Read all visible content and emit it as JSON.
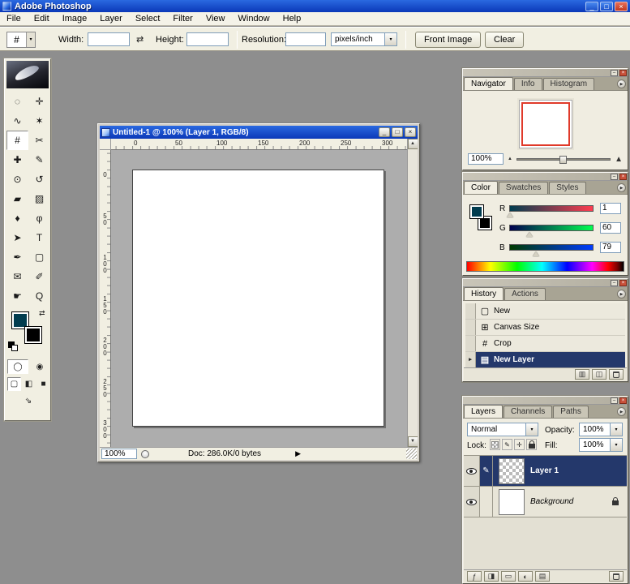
{
  "app": {
    "title": "Adobe Photoshop",
    "window_buttons": {
      "minimize": "_",
      "maximize": "□",
      "close": "×"
    }
  },
  "menu_bar": {
    "items": [
      "File",
      "Edit",
      "Image",
      "Layer",
      "Select",
      "Filter",
      "View",
      "Window",
      "Help"
    ]
  },
  "options_bar": {
    "tool_icon_glyph": "#",
    "tool_dropdown_glyph": "▾",
    "width_label": "Width:",
    "width_value": "",
    "swap_glyph": "⇄",
    "height_label": "Height:",
    "height_value": "",
    "resolution_label": "Resolution:",
    "resolution_value": "",
    "resolution_unit": "pixels/inch",
    "unit_dropdown_glyph": "▾",
    "front_image_button": "Front Image",
    "clear_button": "Clear"
  },
  "toolbox": {
    "tools": [
      {
        "name": "elliptical-marquee-tool",
        "glyph": "◌"
      },
      {
        "name": "move-tool",
        "glyph": "✛"
      },
      {
        "name": "lasso-tool",
        "glyph": "∿"
      },
      {
        "name": "magic-wand-tool",
        "glyph": "✶"
      },
      {
        "name": "crop-tool",
        "glyph": "#",
        "active": true
      },
      {
        "name": "slice-tool",
        "glyph": "✂"
      },
      {
        "name": "healing-brush-tool",
        "glyph": "✚"
      },
      {
        "name": "brush-tool",
        "glyph": "✎"
      },
      {
        "name": "clone-stamp-tool",
        "glyph": "⊙"
      },
      {
        "name": "history-brush-tool",
        "glyph": "↺"
      },
      {
        "name": "eraser-tool",
        "glyph": "▰"
      },
      {
        "name": "gradient-tool",
        "glyph": "▨"
      },
      {
        "name": "blur-tool",
        "glyph": "♦"
      },
      {
        "name": "dodge-tool",
        "glyph": "φ"
      },
      {
        "name": "path-selection-tool",
        "glyph": "➤"
      },
      {
        "name": "type-tool",
        "glyph": "T"
      },
      {
        "name": "pen-tool",
        "glyph": "✒"
      },
      {
        "name": "shape-tool",
        "glyph": "▢"
      },
      {
        "name": "notes-tool",
        "glyph": "✉"
      },
      {
        "name": "eyedropper-tool",
        "glyph": "✐"
      },
      {
        "name": "hand-tool",
        "glyph": "☛"
      },
      {
        "name": "zoom-tool",
        "glyph": "Q"
      }
    ],
    "foreground_color": "#013c4f",
    "background_color": "#000000",
    "swap_glyph": "⇄",
    "quick_mask_buttons": [
      {
        "name": "standard-mode-button",
        "glyph": "◯",
        "active": true
      },
      {
        "name": "quick-mask-mode-button",
        "glyph": "◉"
      }
    ],
    "screen_mode_buttons": [
      {
        "name": "standard-screen-mode-button",
        "glyph": "▢",
        "active": true
      },
      {
        "name": "full-screen-menubar-mode-button",
        "glyph": "◧"
      },
      {
        "name": "full-screen-mode-button",
        "glyph": "■"
      }
    ],
    "imageready_button": {
      "name": "jump-to-imageready-button",
      "glyph": "⇘"
    }
  },
  "document_window": {
    "title": "Untitled-1 @ 100% (Layer 1, RGB/8)",
    "buttons": {
      "minimize": "_",
      "maximize": "□",
      "close": "×"
    },
    "h_ruler": [
      "0",
      "50",
      "100",
      "150",
      "200",
      "250",
      "300"
    ],
    "v_ruler": [
      "0",
      "50",
      "100",
      "150",
      "200",
      "250",
      "300"
    ],
    "zoom": "100%",
    "status": "Doc: 286.0K/0 bytes",
    "status_arrow": "▶",
    "scroll_up": "▲",
    "scroll_down": "▼"
  },
  "palette_chrome": {
    "minimize": "–",
    "close": "×",
    "menu_arrow": "▶"
  },
  "navigator_palette": {
    "tabs": [
      {
        "label": "Navigator",
        "active": true
      },
      {
        "label": "Info"
      },
      {
        "label": "Histogram"
      }
    ],
    "zoom_value": "100%",
    "zoom_out_glyph": "▲",
    "zoom_in_glyph": "▲",
    "view_box_color": "#e03a2a"
  },
  "color_palette": {
    "tabs": [
      {
        "label": "Color",
        "active": true
      },
      {
        "label": "Swatches"
      },
      {
        "label": "Styles"
      }
    ],
    "foreground_color": "#013c4f",
    "background_color": "#000000",
    "channels": [
      {
        "label": "R",
        "value": 1,
        "max": 255,
        "gradient_from": "#003c4f",
        "gradient_to": "#ff3c4f"
      },
      {
        "label": "G",
        "value": 60,
        "max": 255,
        "gradient_from": "#01004f",
        "gradient_to": "#01ff4f"
      },
      {
        "label": "B",
        "value": 79,
        "max": 255,
        "gradient_from": "#013c00",
        "gradient_to": "#013cff"
      }
    ]
  },
  "history_palette": {
    "tabs": [
      {
        "label": "History",
        "active": true
      },
      {
        "label": "Actions"
      }
    ],
    "selected_pointer": "▸",
    "items": [
      {
        "label": "New",
        "glyph": "▢"
      },
      {
        "label": "Canvas Size",
        "glyph": "⊞"
      },
      {
        "label": "Crop",
        "glyph": "#"
      },
      {
        "label": "New Layer",
        "glyph": "▤",
        "selected": true
      }
    ],
    "buttons": [
      {
        "name": "new-document-from-state-button",
        "glyph": "▥"
      },
      {
        "name": "new-snapshot-button",
        "glyph": "◫"
      },
      {
        "name": "delete-state-button",
        "glyph": "trash"
      }
    ]
  },
  "layers_palette": {
    "tabs": [
      {
        "label": "Layers",
        "active": true
      },
      {
        "label": "Channels"
      },
      {
        "label": "Paths"
      }
    ],
    "blend_mode": "Normal",
    "blend_dropdown_glyph": "▾",
    "opacity_label": "Opacity:",
    "opacity_value": "100%",
    "opacity_dropdown_glyph": "▾",
    "lock_label": "Lock:",
    "fill_label": "Fill:",
    "fill_value": "100%",
    "fill_dropdown_glyph": "▾",
    "lock_buttons": [
      {
        "name": "lock-transparency-button",
        "glyph": "checker"
      },
      {
        "name": "lock-image-button",
        "glyph": "✎"
      },
      {
        "name": "lock-position-button",
        "glyph": "✛"
      },
      {
        "name": "lock-all-button",
        "glyph": "lock"
      }
    ],
    "layers": [
      {
        "name": "Layer 1",
        "selected": true,
        "thumb": "checker",
        "active_brush": true,
        "locked": false
      },
      {
        "name": "Background",
        "selected": false,
        "thumb": "white",
        "locked": true,
        "italic": true
      }
    ],
    "buttons": [
      {
        "name": "add-layer-style-button",
        "glyph": "ƒ"
      },
      {
        "name": "add-layer-mask-button",
        "glyph": "◨"
      },
      {
        "name": "new-layer-set-button",
        "glyph": "▭"
      },
      {
        "name": "new-adjustment-layer-button",
        "glyph": "◐"
      },
      {
        "name": "new-layer-button",
        "glyph": "▤"
      },
      {
        "name": "delete-layer-button",
        "glyph": "trash"
      }
    ]
  },
  "colors": {
    "titlebar_gradient_top": "#2a69e0",
    "titlebar_gradient_bottom": "#0b38b8",
    "selection_blue": "#24386b",
    "workspace_gray": "#8e8e8e",
    "chrome": "#f1efe2"
  }
}
